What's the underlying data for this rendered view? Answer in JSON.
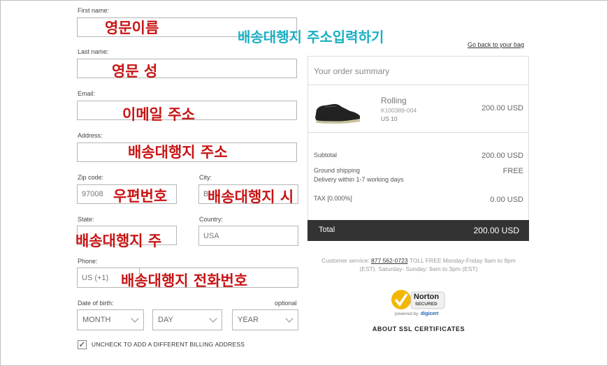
{
  "form": {
    "first_name_label": "First name:",
    "last_name_label": "Last name:",
    "email_label": "Email:",
    "address_label": "Address:",
    "zip_label": "Zip code:",
    "zip_value": "97008",
    "city_label": "City:",
    "city_value": "B",
    "state_label": "State:",
    "country_label": "Country:",
    "country_value": "USA",
    "phone_label": "Phone:",
    "phone_value": "US (+1)",
    "dob_label": "Date of birth:",
    "optional": "optional",
    "month": "MONTH",
    "day": "DAY",
    "year": "YEAR",
    "billing_checkbox_label": "UNCHECK TO ADD A DIFFERENT BILLING ADDRESS",
    "billing_checked": true
  },
  "annotations": {
    "title": "배송대행지 주소입력하기",
    "first_name": "영문이름",
    "last_name": "영문 성",
    "email": "이메일 주소",
    "address": "배송대행지 주소",
    "zip": "우편번호",
    "city": "배송대행지 시",
    "state": "배송대행지 주",
    "phone": "배송대행지 전화번호"
  },
  "back_link": "Go back to your bag",
  "summary": {
    "title": "Your order summary",
    "product": {
      "name": "Rolling",
      "sku": "K100389-004",
      "size": "US 10",
      "price": "200.00 USD",
      "image_icon": "sneaker-icon"
    },
    "subtotal_label": "Subtotal",
    "subtotal_value": "200.00 USD",
    "shipping_label": "Ground shipping",
    "shipping_value": "FREE",
    "delivery_text": "Delivery  within 1-7 working days",
    "tax_label": "TAX [0.000%]",
    "tax_value": "0.00 USD",
    "total_label": "Total",
    "total_value": "200.00  USD"
  },
  "service": {
    "prefix": "Customer service: ",
    "phone": "877 562-0723",
    "suffix": " TOLL FREE Monday-Friday 9am to 9pm",
    "line2": "(EST). Saturday- Sunday: 9am to 3pm (EST)"
  },
  "norton": {
    "name": "Norton",
    "secured": "SECURED",
    "powered": "powered by",
    "digicert": "digicert",
    "ssl_link": "ABOUT SSL CERTIFICATES"
  },
  "colors": {
    "annotation_red": "#c81414",
    "annotation_teal": "#1ab0c2",
    "total_bar": "#333333",
    "norton_yellow": "#f2b705"
  }
}
